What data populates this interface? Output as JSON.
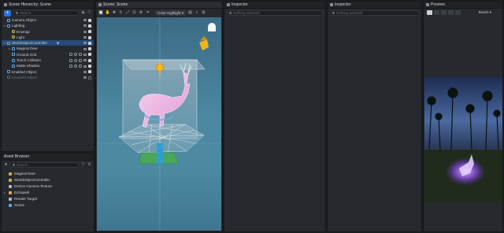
{
  "hierarchy": {
    "title": "Scene Hierarchy: Scene",
    "add_label": "+",
    "search_placeholder": "Search",
    "items": [
      {
        "label": "Camera Object",
        "kind": "camera",
        "indent": 0
      },
      {
        "label": "Lighting",
        "kind": "folder",
        "indent": 0
      },
      {
        "label": "Envmap",
        "kind": "light",
        "indent": 1
      },
      {
        "label": "Light",
        "kind": "light",
        "indent": 1
      },
      {
        "label": "WorldObjectController",
        "kind": "controller",
        "indent": 0,
        "selected": true
      },
      {
        "label": "Magical Deer",
        "kind": "object",
        "indent": 1
      },
      {
        "label": "Ground Grid",
        "kind": "object",
        "indent": 1
      },
      {
        "label": "Touch Collision",
        "kind": "object",
        "indent": 1
      },
      {
        "label": "Matte Shadow",
        "kind": "object",
        "indent": 1
      },
      {
        "label": "Enabled Object",
        "kind": "object",
        "indent": 0
      },
      {
        "label": "Disabled Object",
        "kind": "object",
        "indent": 0,
        "disabled": true
      }
    ]
  },
  "assets": {
    "title": "Asset Browser",
    "add_label": "+",
    "search_placeholder": "Search...",
    "items": [
      {
        "label": "Magical Deer",
        "color": "#e0a94a"
      },
      {
        "label": "WorldObjectController",
        "color": "#e0a94a"
      },
      {
        "label": "Device Camera Texture",
        "color": "#b0b7c0"
      },
      {
        "label": "Echopark",
        "color": "#e0a94a"
      },
      {
        "label": "Render Target",
        "color": "#b0b7c0"
      },
      {
        "label": "Scene",
        "color": "#5aa8e6"
      }
    ]
  },
  "scene": {
    "title": "Scene: Scene",
    "dropdown": "Color Highlight"
  },
  "inspector1": {
    "title": "Inspector",
    "placeholder": "Nothing selected"
  },
  "inspector2": {
    "title": "Inspector",
    "placeholder": "Nothing selected"
  },
  "preview": {
    "title": "Preview",
    "device": "Beach"
  }
}
